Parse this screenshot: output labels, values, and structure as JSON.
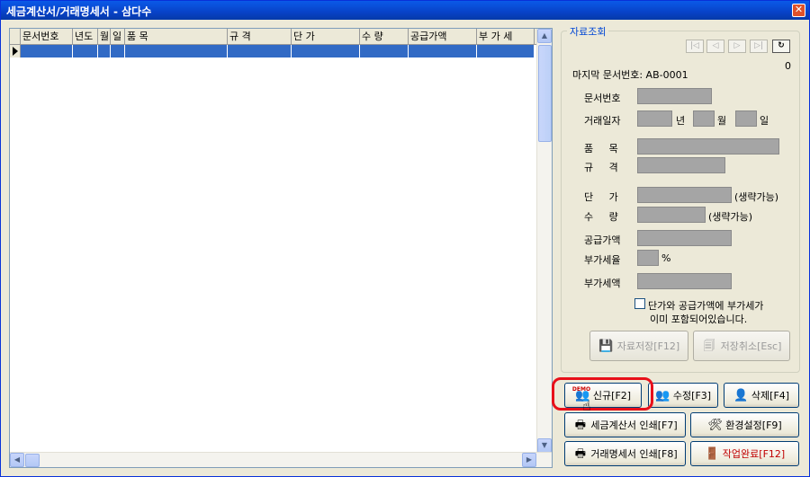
{
  "window": {
    "title": "세금계산서/거래명세서 - 삼다수",
    "close_label": "✕"
  },
  "grid": {
    "columns": [
      {
        "label": "문서번호",
        "w": 58
      },
      {
        "label": "년도",
        "w": 28
      },
      {
        "label": "월",
        "w": 14
      },
      {
        "label": "일",
        "w": 16
      },
      {
        "label": "품 목",
        "w": 114
      },
      {
        "label": "규 격",
        "w": 71
      },
      {
        "label": "단 가",
        "w": 76
      },
      {
        "label": "수 량",
        "w": 54
      },
      {
        "label": "공급가액",
        "w": 76
      },
      {
        "label": "부 가 세",
        "w": 64
      }
    ]
  },
  "panel": {
    "group_title": "자료조회",
    "record_count": "0",
    "last_doc": "마지막 문서번호: AB-0001",
    "labels": {
      "doc_no": "문서번호",
      "trade_date": "거래일자",
      "year": "년",
      "month": "월",
      "day": "일",
      "item": "품     목",
      "spec": "규     격",
      "price": "단     가",
      "qty": "수     량",
      "supply": "공급가액",
      "vat_rate": "부가세율",
      "vat": "부가세액",
      "optional1": "(생략가능)",
      "optional2": "(생략가능)",
      "percent": "%",
      "vat_included_1": "단가와 공급가액에 부가세가",
      "vat_included_2": "이미 포함되어있습니다."
    },
    "save_label": "자료저장[F12]",
    "cancel_label": "저장취소[Esc]"
  },
  "actions": {
    "new": "신규[F2]",
    "edit": "수정[F3]",
    "delete": "삭제[F4]",
    "print_tax": "세금계산서 인쇄[F7]",
    "settings": "환경설정[F9]",
    "print_stmt": "거래명세서 인쇄[F8]",
    "finish": "작업완료[F12]",
    "new_badge": "DEMO"
  },
  "colors": {
    "accent": "#0046d5",
    "selection": "#316ac5",
    "finish_text": "#c00000",
    "highlight": "#e8101a"
  }
}
